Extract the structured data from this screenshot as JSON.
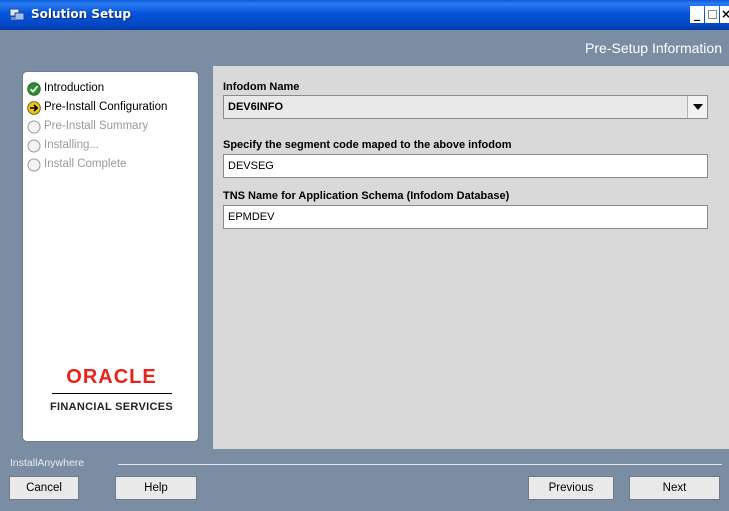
{
  "window": {
    "title": "Solution Setup",
    "minimize_glyph": "_",
    "close_glyph": "×"
  },
  "header": {
    "title": "Pre-Setup Information"
  },
  "steps": [
    {
      "label": "Introduction",
      "state": "done",
      "icon": "check-icon"
    },
    {
      "label": "Pre-Install Configuration",
      "state": "current",
      "icon": "arrow-right-icon"
    },
    {
      "label": "Pre-Install Summary",
      "state": "pending",
      "icon": "circle-icon"
    },
    {
      "label": "Installing...",
      "state": "pending",
      "icon": "circle-icon"
    },
    {
      "label": "Install Complete",
      "state": "pending",
      "icon": "circle-icon"
    }
  ],
  "brand": {
    "name": "ORACLE",
    "tagline": "FINANCIAL SERVICES"
  },
  "form": {
    "infodom_label": "Infodom Name",
    "infodom_value": "DEV6INFO",
    "segment_label": "Specify the segment code maped to the above infodom",
    "segment_value": "DEVSEG",
    "tns_label": "TNS Name for Application Schema (Infodom Database)",
    "tns_value": "EPMDEV"
  },
  "footer": {
    "installer_label": "InstallAnywhere",
    "cancel_label": "Cancel",
    "help_label": "Help",
    "previous_label": "Previous",
    "next_label": "Next"
  },
  "colors": {
    "titlebar": "#0453d9",
    "panel": "#7b8da3",
    "content": "#d9d9d9",
    "brand_red": "#e8231a",
    "step_done": "#2e8b2e",
    "step_current": "#f0c419"
  }
}
